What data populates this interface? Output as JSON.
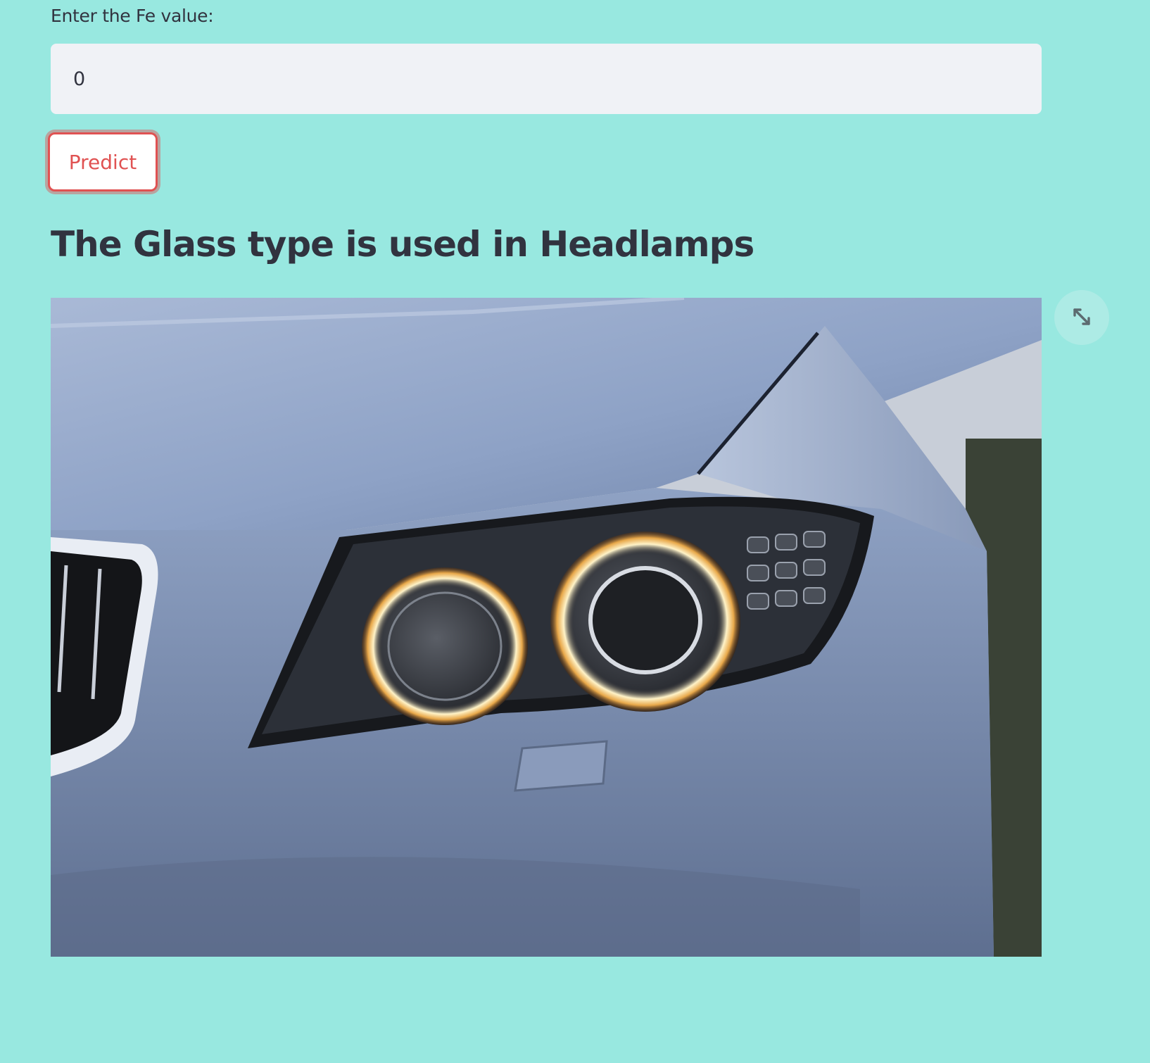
{
  "form": {
    "fe_label": "Enter the Fe value:",
    "fe_value": "0",
    "predict_label": "Predict"
  },
  "result": {
    "heading": "The Glass type is used in Headlamps"
  },
  "image": {
    "fullscreen_icon": "expand-icon"
  },
  "colors": {
    "page_background": "#98e8e0",
    "input_background": "#f0f2f6",
    "accent": "#e05252",
    "text": "#31333f"
  }
}
